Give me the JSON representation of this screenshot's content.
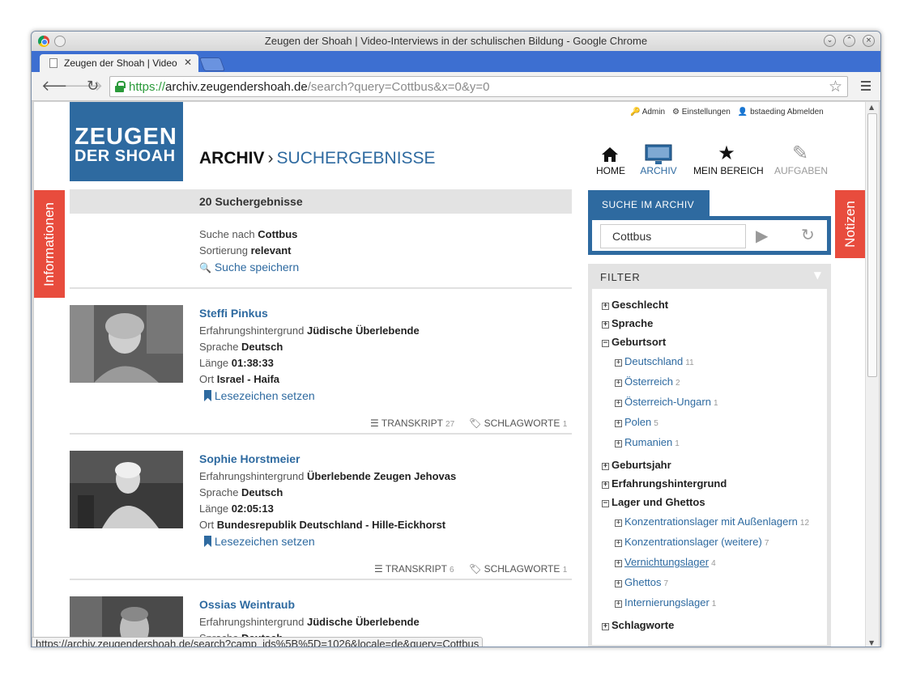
{
  "browser": {
    "window_title": "Zeugen der Shoah | Video-Interviews in der schulischen Bildung - Google Chrome",
    "tab_title": "Zeugen der Shoah | Video",
    "tab_close": "✕",
    "url_scheme": "https://",
    "url_host": "archiv.zeugendershoah.de",
    "url_path": "/search?query=Cottbus&x=0&y=0",
    "status_url": "https://archiv.zeugendershoah.de/search?camp_ids%5B%5D=1026&locale=de&query=Cottbus"
  },
  "logo": {
    "line1": "ZEUGEN",
    "line2": "DER SHOAH"
  },
  "breadcrumb": {
    "root": "ARCHIV",
    "separator": "›",
    "current": "SUCHERGEBNISSE"
  },
  "usernav": {
    "admin": "Admin",
    "settings": "Einstellungen",
    "user": "bstaeding",
    "logout": "Abmelden"
  },
  "mainnav": {
    "home": "HOME",
    "archiv": "ARCHIV",
    "mein_bereich": "MEIN BEREICH",
    "aufgaben": "AUFGABEN"
  },
  "side_tabs": {
    "left": "Informationen",
    "right": "Notizen"
  },
  "results": {
    "count_label": "20 Suchergebnisse",
    "query_label": "Suche nach",
    "query_value": "Cottbus",
    "sort_label": "Sortierung",
    "sort_value": "relevant",
    "save_search": "Suche speichern",
    "labels": {
      "background": "Erfahrungshintergrund",
      "language": "Sprache",
      "length": "Länge",
      "place": "Ort",
      "bookmark": "Lesezeichen setzen",
      "transcript": "TRANSKRIPT",
      "keywords": "SCHLAGWORTE"
    },
    "items": [
      {
        "name": "Steffi Pinkus",
        "background": "Jüdische Überlebende",
        "language": "Deutsch",
        "length": "01:38:33",
        "place": "Israel - Haifa",
        "transcript_count": "27",
        "keywords_count": "1"
      },
      {
        "name": "Sophie Horstmeier",
        "background": "Überlebende Zeugen Jehovas",
        "language": "Deutsch",
        "length": "02:05:13",
        "place": "Bundesrepublik Deutschland - Hille-Eickhorst",
        "transcript_count": "6",
        "keywords_count": "1"
      },
      {
        "name": "Ossias Weintraub",
        "background": "Jüdische Überlebende",
        "language": "Deutsch"
      }
    ]
  },
  "search": {
    "tab_label": "SUCHE IM ARCHIV",
    "input_value": "Cottbus"
  },
  "filter": {
    "title": "FILTER",
    "groups": [
      {
        "label": "Geschlecht",
        "expanded": false
      },
      {
        "label": "Sprache",
        "expanded": false
      },
      {
        "label": "Geburtsort",
        "expanded": true,
        "items": [
          {
            "label": "Deutschland",
            "count": "11"
          },
          {
            "label": "Österreich",
            "count": "2"
          },
          {
            "label": "Österreich-Ungarn",
            "count": "1"
          },
          {
            "label": "Polen",
            "count": "5"
          },
          {
            "label": "Rumanien",
            "count": "1"
          }
        ]
      },
      {
        "label": "Geburtsjahr",
        "expanded": false
      },
      {
        "label": "Erfahrungshintergrund",
        "expanded": false
      },
      {
        "label": "Lager und Ghettos",
        "expanded": true,
        "items": [
          {
            "label": "Konzentrationslager mit Außenlagern",
            "count": "12"
          },
          {
            "label": "Konzentrationslager (weitere)",
            "count": "7"
          },
          {
            "label": "Vernichtungslager",
            "count": "4"
          },
          {
            "label": "Ghettos",
            "count": "7"
          },
          {
            "label": "Internierungslager",
            "count": "1"
          }
        ]
      },
      {
        "label": "Schlagworte",
        "expanded": false
      }
    ]
  }
}
